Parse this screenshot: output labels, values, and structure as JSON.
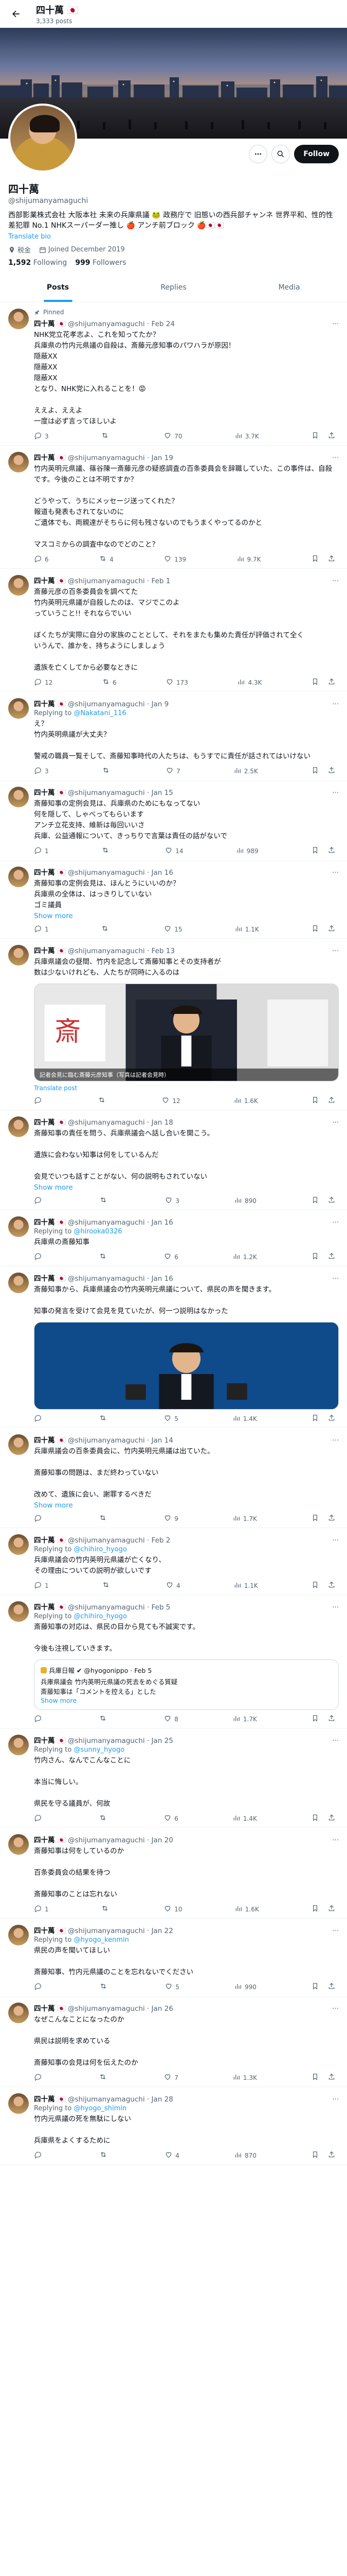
{
  "header": {
    "title": "四十萬 🇯🇵",
    "subtitle": "3,333 posts"
  },
  "profile": {
    "name": "四十萬",
    "handle": "@shijumanyamaguchi",
    "bio": "西部影業株式会社 大阪本社 未来の兵庫県議 🐸 政務庁で 旧態いの西兵部チャンネ 世界平和、性的性差犯罪 No.1 NHKスーパーダー推し 🍎 アンチ前ブロック 🍎🇯🇵🇯🇵",
    "translate": "Translate bio",
    "location": "税金",
    "joined": "Joined December 2019",
    "following_count": "1,592",
    "following_label": "Following",
    "followers_count": "999",
    "followers_label": "Followers",
    "follow_label": "Follow"
  },
  "tabs": [
    {
      "label": "Posts"
    },
    {
      "label": "Replies"
    },
    {
      "label": "Media"
    }
  ],
  "posts": [
    {
      "pinned": "Pinned",
      "name": "四十萬 🇯🇵",
      "meta": "@shijumanyamaguchi · Feb 24",
      "text": "NHK党立花孝志よ、これを知ってたか？\n兵庫県の竹内元県議の自殺は、斎藤元彦知事のパワハラが原因！\n隠蔽XX\n隠蔽XX\n隠蔽XX\nとなり、NHK党に入れることを！😡\n\nええよ、ええよ\n一度は必ず言ってほしいよ",
      "replies": "3",
      "reposts": "",
      "likes": "70",
      "views": "3.7K"
    },
    {
      "name": "四十萬 🇯🇵",
      "meta": "@shijumanyamaguchi · Jan 19",
      "text": "竹内英明元県議、篠谷陳一斎藤元彦の疑惑調査の百条委員会を辞職していた、この事件は、自殺です。今後のことは不明ですか？\n\nどうやって、うちにメッセージ送ってくれた？\n報道も発表もされてないのに\nご遺体でも、両親達がそちらに何も残さないのでもうまくやってるのかと\n\nマスコミからの調査中なのでどのこと？",
      "replies": "6",
      "reposts": "4",
      "likes": "139",
      "views": "9.7K"
    },
    {
      "name": "四十萬 🇯🇵",
      "meta": "@shijumanyamaguchi · Feb 1",
      "text": "斎藤元彦の百条委員会を調べてた\n竹内英明元県議が自殺したのは、マジでこのよ\nっていうこと!! それならでいい\n\nぼくたちが実際に自分の家族のこととして、それをまたも集めた責任が評価されて全く\nいうんで、誰かを、持ちようにしましょう\n\n遺族を亡くしてから必要なときに",
      "replies": "12",
      "reposts": "6",
      "likes": "173",
      "views": "4.3K"
    },
    {
      "name": "四十萬 🇯🇵",
      "meta": "@shijumanyamaguchi · Jan 9",
      "reply_to": "@Nakatani_116",
      "text": "え？\n竹内英明県議が大丈夫？\n\n警戒の職員一覧そして、斎藤知事時代の人たちは、もうすでに責任が話されてはいけない",
      "replies": "3",
      "reposts": "",
      "likes": "7",
      "views": "2.5K"
    },
    {
      "name": "四十萬 🇯🇵",
      "meta": "@shijumanyamaguchi · Jan 15",
      "text": "斎藤知事の定例会見は、兵庫県のためにもなってない\n何を隠して、しゃべってもらいます\nアンチ立花支持、維新は毎回いいさ\n兵庫、公益通報について、きっちりで言葉は責任の話がないで",
      "replies": "1",
      "reposts": "",
      "likes": "14",
      "views": "989"
    },
    {
      "name": "四十萬 🇯🇵",
      "meta": "@shijumanyamaguchi · Jan 16",
      "text": "斎藤知事の定例会見は、ほんとうにいいのか？\n兵庫県の全体は、はっきりしていない\nゴミ議員",
      "replies": "1",
      "reposts": "",
      "likes": "15",
      "views": "1.1K",
      "show_more": "Show more"
    },
    {
      "name": "四十萬 🇯🇵",
      "meta": "@shijumanyamaguchi · Feb 13",
      "text": "兵庫県議会の昼間、竹内を記念して斎藤知事とその支持者が\n数は少ないけれども、人たちが同時に入るのは",
      "replies": "",
      "reposts": "",
      "likes": "12",
      "views": "1.6K",
      "media_caption": "記者会見に臨む斎藤元彦知事（写真は記者会見時）",
      "translate": "Translate post"
    },
    {
      "name": "四十萬 🇯🇵",
      "meta": "@shijumanyamaguchi · Jan 18",
      "text": "斎藤知事の責任を問う、兵庫県議会へ話し合いを開こう。\n\n遺族に会わない知事は何をしているんだ\n\n会見でいつも話すことがない、何の説明もされていない",
      "replies": "",
      "reposts": "",
      "likes": "3",
      "views": "890",
      "show_more": "Show more"
    },
    {
      "name": "四十萬 🇯🇵",
      "meta": "@shijumanyamaguchi · Jan 16",
      "reply_to": "@hirooka0326",
      "text": "兵庫県の斎藤知事",
      "replies": "",
      "reposts": "",
      "likes": "6",
      "views": "1.2K"
    },
    {
      "name": "四十萬 🇯🇵",
      "meta": "@shijumanyamaguchi · Jan 16",
      "text": "斎藤知事から、兵庫県議会の竹内英明元県議について、県民の声を聞きます。\n\n知事の発言を受けて会見を見ていたが、何一つ説明はなかった",
      "replies": "",
      "reposts": "",
      "likes": "5",
      "views": "1.4K",
      "media_caption": "",
      "translate": ""
    },
    {
      "name": "四十萬 🇯🇵",
      "meta": "@shijumanyamaguchi · Jan 14",
      "text": "兵庫県議会の百条委員会に、竹内英明元県議は出ていた。\n\n斎藤知事の問題は、まだ終わっていない\n\n改めて、遺族に会い、謝罪するべきだ",
      "replies": "",
      "reposts": "",
      "likes": "9",
      "views": "1.7K",
      "show_more": "Show more"
    },
    {
      "name": "四十萬 🇯🇵",
      "meta": "@shijumanyamaguchi · Feb 2",
      "reply_to": "@chihiro_hyogo",
      "text": "兵庫県議会の竹内英明元県議が亡くなり、\nその理由についての説明が欲しいです",
      "replies": "1",
      "reposts": "",
      "likes": "4",
      "views": "1.1K"
    },
    {
      "name": "四十萬 🇯🇵",
      "meta": "@shijumanyamaguchi · Feb 5",
      "reply_to": "@chihiro_hyogo",
      "text": "斎藤知事の対応は、県民の目から見ても不誠実です。\n\n今後も注視していきます。",
      "replies": "",
      "reposts": "",
      "likes": "8",
      "views": "1.7K",
      "quote_name": "兵庫日報 ✔ @hyogonippo · Feb 5",
      "quote_text": "兵庫県議会 竹内英明元県議の死去をめぐる質疑\n斎藤知事は「コメントを控える」とした",
      "quote_link": "Show more"
    },
    {
      "name": "四十萬 🇯🇵",
      "meta": "@shijumanyamaguchi · Jan 25",
      "reply_to": "@sunny_hyogo",
      "text": "竹内さん、なんでこんなことに\n\n本当に悔しい。\n\n県民を守る議員が、何故",
      "replies": "",
      "reposts": "",
      "likes": "6",
      "views": "1.4K"
    },
    {
      "name": "四十萬 🇯🇵",
      "meta": "@shijumanyamaguchi · Jan 20",
      "text": "斎藤知事は何をしているのか\n\n百条委員会の結果を待つ\n\n斎藤知事のことは忘れない",
      "replies": "1",
      "reposts": "",
      "likes": "10",
      "views": "1.6K"
    },
    {
      "name": "四十萬 🇯🇵",
      "meta": "@shijumanyamaguchi · Jan 22",
      "reply_to": "@hyogo_kenmin",
      "text": "県民の声を聞いてほしい\n\n斎藤知事、竹内元県議のことを忘れないでください",
      "replies": "",
      "reposts": "",
      "likes": "5",
      "views": "990"
    },
    {
      "name": "四十萬 🇯🇵",
      "meta": "@shijumanyamaguchi · Jan 26",
      "text": "なぜこんなことになったのか\n\n県民は説明を求めている\n\n斎藤知事の会見は何を伝えたのか",
      "replies": "",
      "reposts": "",
      "likes": "7",
      "views": "1.3K"
    },
    {
      "name": "四十萬 🇯🇵",
      "meta": "@shijumanyamaguchi · Jan 28",
      "reply_to": "@hyogo_shimin",
      "text": "竹内元県議の死を無駄にしない\n\n兵庫県をよくするために",
      "replies": "",
      "reposts": "",
      "likes": "4",
      "views": "870"
    }
  ]
}
